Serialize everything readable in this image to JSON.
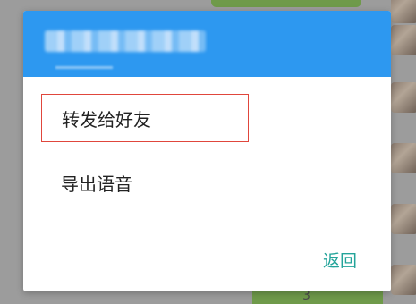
{
  "dialog": {
    "menu_items": [
      {
        "label": "转发给好友"
      },
      {
        "label": "导出语音"
      }
    ],
    "back_label": "返回"
  },
  "background": {
    "bubble_number": "3"
  },
  "colors": {
    "header_blue": "#2d98f0",
    "highlight_border": "#e0463c",
    "back_link": "#23a49a",
    "overlay": "#9c9c9c"
  }
}
